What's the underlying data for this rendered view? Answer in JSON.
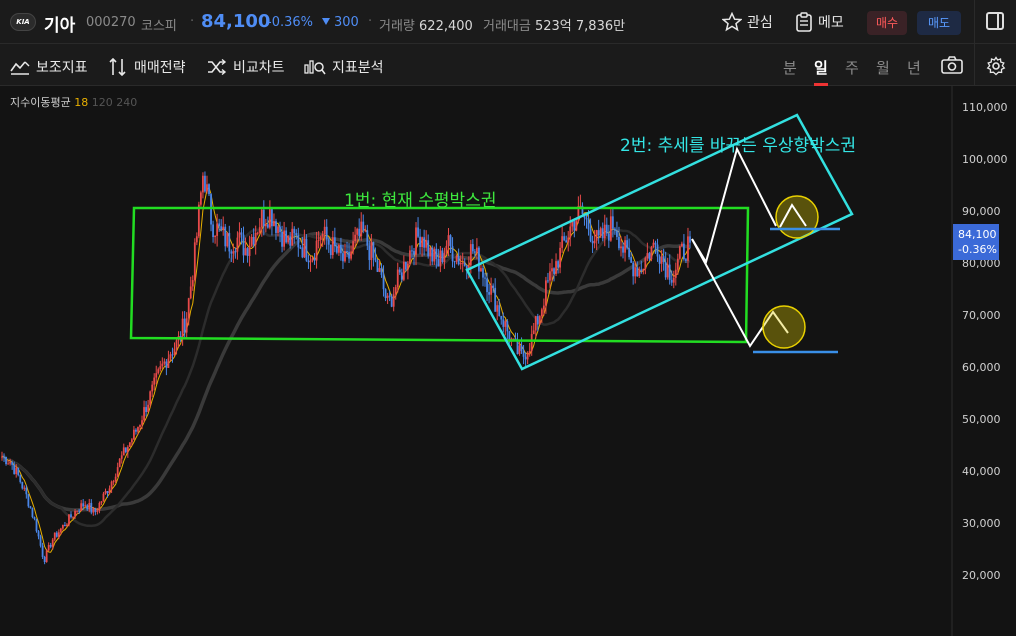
{
  "header": {
    "stock_name": "기아",
    "stock_code": "000270",
    "market": "코스피",
    "price": "84,100",
    "change_pct": "-0.36%",
    "change_abs": "300",
    "volume_label": "거래량",
    "volume_value": "622,400",
    "trade_amount_label": "거래대금",
    "trade_amount_value": "523억 7,836만",
    "watch_label": "관심",
    "memo_label": "메모",
    "buy_label": "매수",
    "sell_label": "매도",
    "colors": {
      "down": "#4f8df5",
      "up": "#ff5a5a"
    }
  },
  "toolbar": {
    "indicator_label": "보조지표",
    "strategy_label": "매매전략",
    "compare_label": "비교차트",
    "analysis_label": "지표분석",
    "periods": [
      "분",
      "일",
      "주",
      "월",
      "년"
    ],
    "active_period": "일"
  },
  "chart": {
    "ma_label": "지수이동평균",
    "ma_periods": [
      "18",
      "120",
      "240"
    ],
    "y_axis_ticks": [
      "110,000",
      "100,000",
      "90,000",
      "80,000",
      "70,000",
      "60,000",
      "50,000",
      "40,000",
      "30,000",
      "20,000"
    ],
    "current_price_tag": "84,100",
    "current_change_tag": "-0.36%",
    "annotation_1": "1번: 현재 수평박스권",
    "annotation_2": "2번: 추세를 바꾸는 우상향박스권",
    "colors": {
      "box1": "#22dd22",
      "box2": "#33e0e0",
      "candle_up": "#e84a4a",
      "candle_down": "#4a86e8",
      "ma18": "#e8b000"
    }
  },
  "chart_data": {
    "type": "candlestick",
    "title": "",
    "ylim": [
      15000,
      115000
    ],
    "yticks": [
      110000,
      100000,
      90000,
      80000,
      70000,
      60000,
      50000,
      40000,
      30000,
      20000
    ],
    "approx_close_path": [
      43000,
      42000,
      39000,
      35000,
      30000,
      23000,
      27000,
      29000,
      31000,
      33000,
      34000,
      32000,
      35000,
      38000,
      42000,
      45000,
      48000,
      52000,
      56000,
      60000,
      63000,
      65000,
      70000,
      82000,
      98000,
      88000,
      86000,
      84000,
      85000,
      83000,
      86000,
      89000,
      90000,
      87000,
      84000,
      85000,
      83000,
      82000,
      86000,
      84000,
      82000,
      80000,
      84000,
      86000,
      82000,
      78000,
      72000,
      76000,
      80000,
      84000,
      86000,
      82000,
      80000,
      84000,
      82000,
      80000,
      83000,
      80000,
      76000,
      72000,
      68000,
      64000,
      62000,
      65000,
      70000,
      76000,
      80000,
      84000,
      88000,
      90000,
      87000,
      84000,
      86000,
      88000,
      83000,
      80000,
      79000,
      82000,
      84000,
      80000,
      78000,
      82000,
      84100
    ],
    "current_price": 84100
  }
}
